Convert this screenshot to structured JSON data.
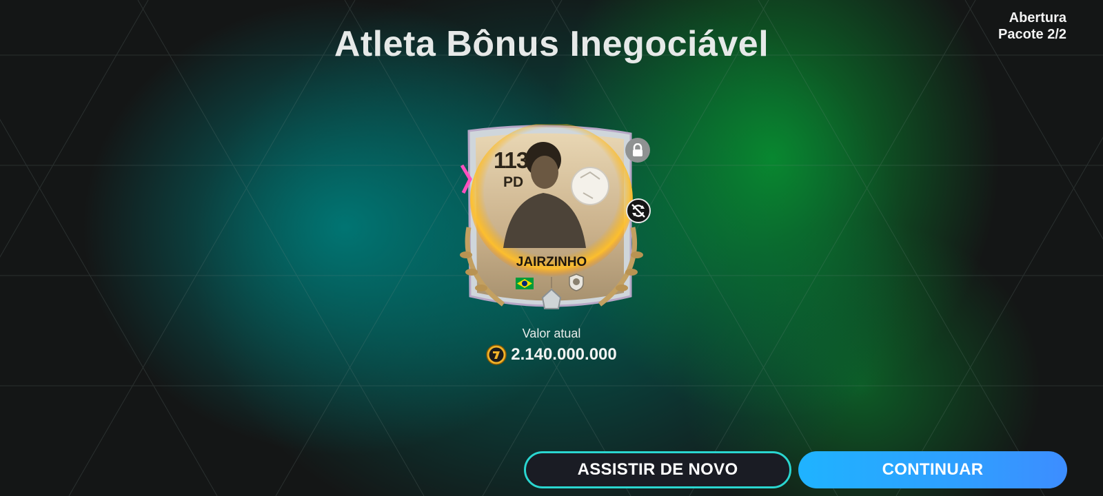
{
  "header": {
    "title": "Atleta Bônus Inegociável",
    "pack_label": "Abertura",
    "pack_count": "Pacote 2/2"
  },
  "card": {
    "rating": "113",
    "position": "PD",
    "name": "JAIRZINHO",
    "nation_icon": "brazil-flag-icon",
    "club_icon": "club-badge-icon",
    "lock_icon": "lock-icon",
    "untradeable_icon": "untradeable-icon"
  },
  "value": {
    "label": "Valor atual",
    "coin_icon": "fc-coin-icon",
    "amount": "2.140.000.000"
  },
  "buttons": {
    "replay_label": "ASSISTIR DE NOVO",
    "continue_label": "CONTINUAR"
  },
  "colors": {
    "teal_glow": "#007876",
    "green_glow": "#088c30",
    "replay_border": "#2ad6d0",
    "continue_fill": "#1fb3ff",
    "background": "#121414"
  }
}
